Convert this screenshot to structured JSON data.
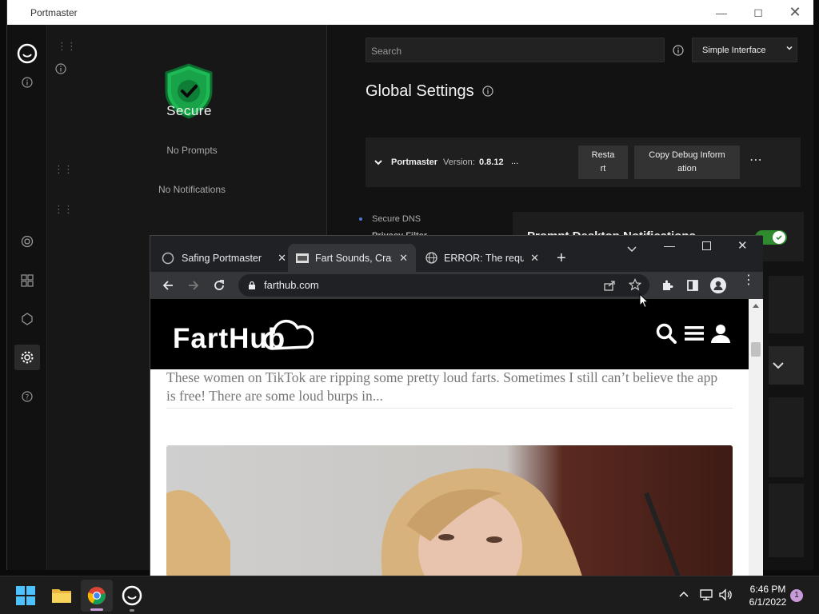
{
  "portmaster": {
    "title": "Portmaster",
    "status": "Secure",
    "no_prompts": "No Prompts",
    "no_notifications": "No Notifications",
    "search_placeholder": "Search",
    "interface_mode": "Simple Interface",
    "page_title": "Global Settings",
    "version_card": {
      "name": "Portmaster",
      "version_label": "Version:",
      "version_value": "0.8.12",
      "ellipsis": "...",
      "restart_label": "Resta\nrt",
      "copy_debug_label": "Copy Debug Inform\nation"
    },
    "nav_items": [
      "Secure DNS",
      "Privacy Filter"
    ],
    "setting_title": "Prompt Desktop Notifications",
    "setting_enabled": true,
    "accent_color": "#2e8b2e"
  },
  "chrome": {
    "tabs": [
      {
        "label": "Safing Portmaster",
        "active": false,
        "icon": "portmaster-favicon"
      },
      {
        "label": "Fart Sounds, Crazy",
        "active": true,
        "icon": "farthub-favicon"
      },
      {
        "label": "ERROR: The reque",
        "active": false,
        "icon": "globe-icon"
      }
    ],
    "url": "farthub.com",
    "site": {
      "logo": "FartHub",
      "excerpt": "These women on TikTok are ripping some pretty loud farts.  Sometimes I still can’t believe the app is free!  There are some loud burps in..."
    }
  },
  "taskbar": {
    "apps": [
      "start-icon",
      "file-explorer-icon",
      "chrome-icon",
      "portmaster-icon"
    ],
    "time": "6:46 PM",
    "date": "6/1/2022",
    "notification_count": "1"
  }
}
